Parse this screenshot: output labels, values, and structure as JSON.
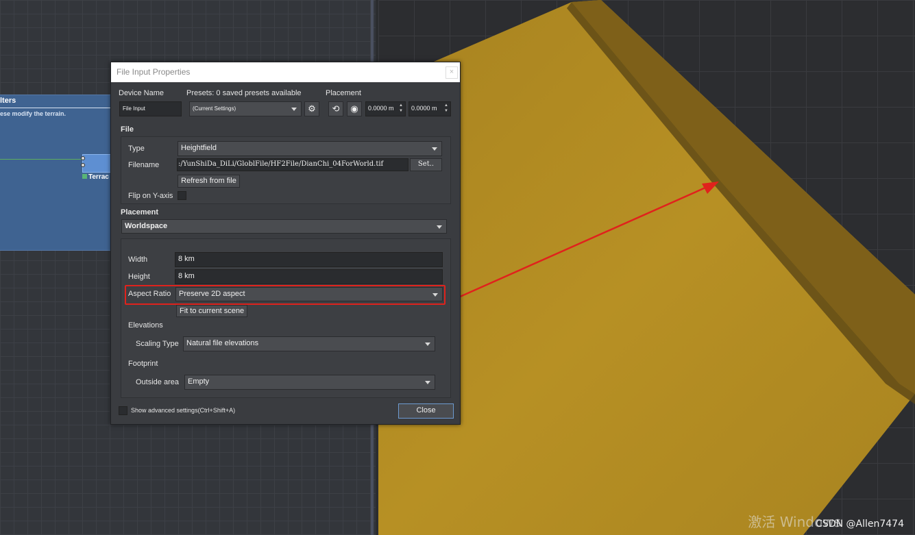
{
  "graph": {
    "group_title": "lters",
    "group_desc": "ese modify the terrain.",
    "node_label": "Terrac"
  },
  "dialog": {
    "title": "File Input Properties",
    "close_x": "×",
    "device_name_label": "Device Name",
    "device_name_value": "File Input",
    "presets_label": "Presets: 0 saved presets available",
    "presets_value": "(Current Settings)",
    "placement_header": "Placement",
    "placement_x": "0.0000 m",
    "placement_y": "0.0000 m",
    "file_header": "File",
    "type_label": "Type",
    "type_value": "Heightfield",
    "filename_label": "Filename",
    "filename_value": ":/YunShiDa_DiLi/GloblFile/HF2File/DianChi_04ForWorld.tif",
    "set_button": "Set..",
    "refresh_button": "Refresh from file",
    "flip_label": "Flip on Y-axis",
    "placement_label": "Placement",
    "placement_value": "Worldspace",
    "width_label": "Width",
    "width_value": "8 km",
    "height_label": "Height",
    "height_value": "8 km",
    "aspect_label": "Aspect Ratio",
    "aspect_value": "Preserve 2D aspect",
    "fit_button": "Fit to current scene",
    "elevations_label": "Elevations",
    "scaling_label": "Scaling Type",
    "scaling_value": "Natural file elevations",
    "footprint_label": "Footprint",
    "outside_label": "Outside area",
    "outside_value": "Empty",
    "advanced_label": "Show advanced settings(Ctrl+Shift+A)",
    "close_button": "Close"
  },
  "viewport": {
    "watermark": "激活 Windows",
    "credit": "CSDN @Allen7474"
  },
  "colors": {
    "terrain": "#b08a22",
    "terrain_edge": "#7a5e1c",
    "annotation_red": "#e0221c",
    "node_blue": "#5e8fd2"
  }
}
